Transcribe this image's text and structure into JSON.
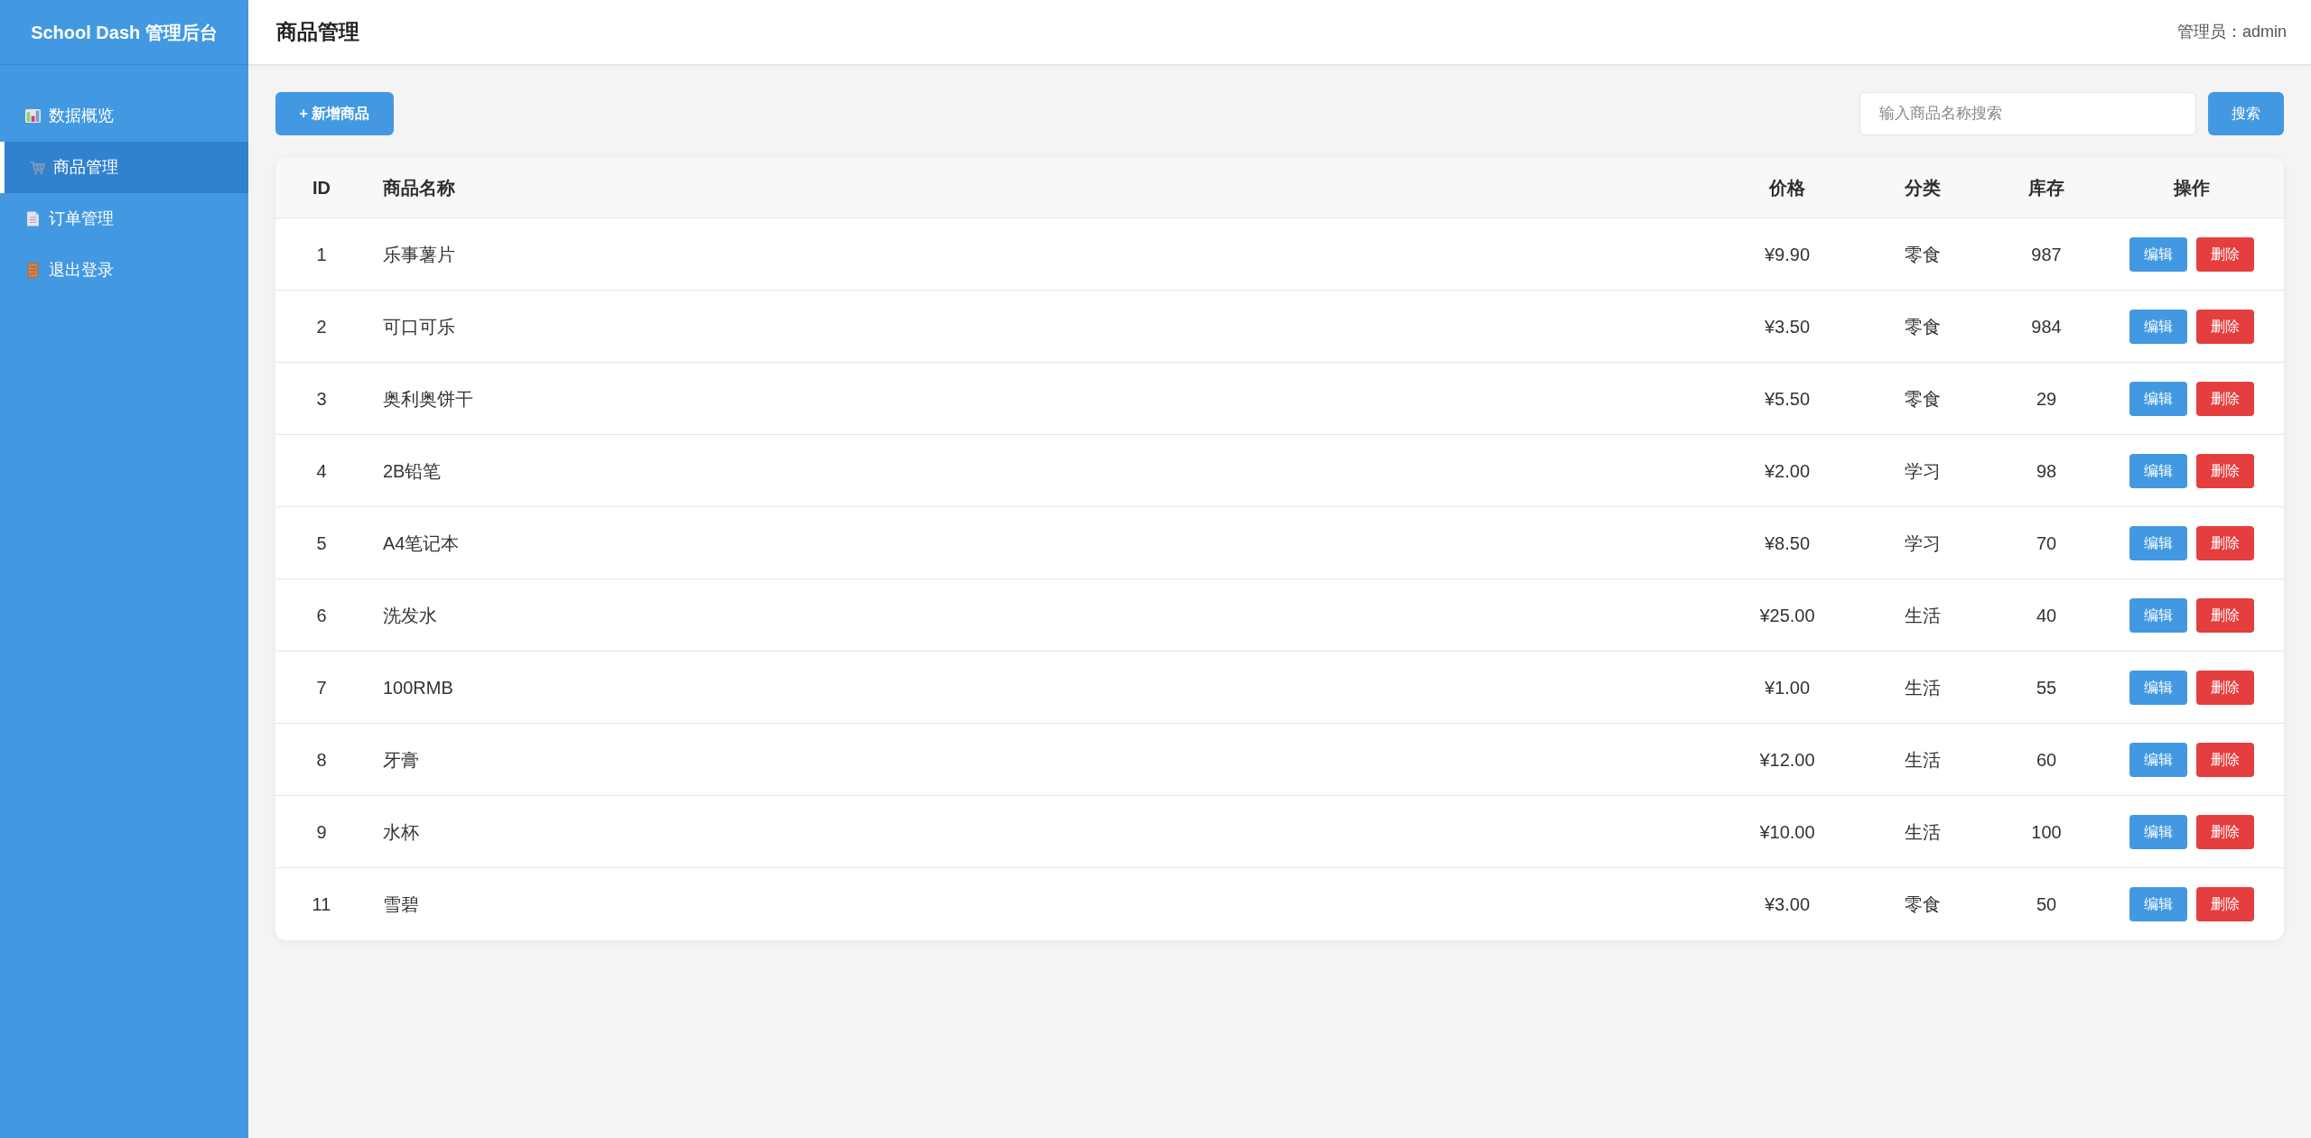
{
  "sidebar": {
    "title": "School Dash 管理后台",
    "items": [
      {
        "label": "数据概览",
        "kind": "dashboard",
        "selected": false
      },
      {
        "label": "商品管理",
        "kind": "products",
        "selected": true
      },
      {
        "label": "订单管理",
        "kind": "orders",
        "selected": false
      },
      {
        "label": "退出登录",
        "kind": "logout",
        "selected": false
      }
    ]
  },
  "header": {
    "title": "商品管理",
    "user": "管理员：admin"
  },
  "toolbar": {
    "add_button": "+ 新增商品",
    "search": {
      "placeholder": "输入商品名称搜索"
    },
    "search_button": "搜索"
  },
  "table": {
    "columns": [
      "ID",
      "商品名称",
      "价格",
      "分类",
      "库存",
      "操作"
    ],
    "rows": [
      {
        "cells": [
          "1",
          "乐事薯片",
          "¥9.90",
          "零食",
          "987"
        ],
        "actions": [
          {
            "label": "编辑",
            "kind": "edit"
          },
          {
            "label": "删除",
            "kind": "delete"
          }
        ]
      },
      {
        "cells": [
          "2",
          "可口可乐",
          "¥3.50",
          "零食",
          "984"
        ],
        "actions": [
          {
            "label": "编辑",
            "kind": "edit"
          },
          {
            "label": "删除",
            "kind": "delete"
          }
        ]
      },
      {
        "cells": [
          "3",
          "奥利奥饼干",
          "¥5.50",
          "零食",
          "29"
        ],
        "actions": [
          {
            "label": "编辑",
            "kind": "edit"
          },
          {
            "label": "删除",
            "kind": "delete"
          }
        ]
      },
      {
        "cells": [
          "4",
          "2B铅笔",
          "¥2.00",
          "学习",
          "98"
        ],
        "actions": [
          {
            "label": "编辑",
            "kind": "edit"
          },
          {
            "label": "删除",
            "kind": "delete"
          }
        ]
      },
      {
        "cells": [
          "5",
          "A4笔记本",
          "¥8.50",
          "学习",
          "70"
        ],
        "actions": [
          {
            "label": "编辑",
            "kind": "edit"
          },
          {
            "label": "删除",
            "kind": "delete"
          }
        ]
      },
      {
        "cells": [
          "6",
          "洗发水",
          "¥25.00",
          "生活",
          "40"
        ],
        "actions": [
          {
            "label": "编辑",
            "kind": "edit"
          },
          {
            "label": "删除",
            "kind": "delete"
          }
        ]
      },
      {
        "cells": [
          "7",
          "100RMB",
          "¥1.00",
          "生活",
          "55"
        ],
        "actions": [
          {
            "label": "编辑",
            "kind": "edit"
          },
          {
            "label": "删除",
            "kind": "delete"
          }
        ]
      },
      {
        "cells": [
          "8",
          "牙膏",
          "¥12.00",
          "生活",
          "60"
        ],
        "actions": [
          {
            "label": "编辑",
            "kind": "edit"
          },
          {
            "label": "删除",
            "kind": "delete"
          }
        ]
      },
      {
        "cells": [
          "9",
          "水杯",
          "¥10.00",
          "生活",
          "100"
        ],
        "actions": [
          {
            "label": "编辑",
            "kind": "edit"
          },
          {
            "label": "删除",
            "kind": "delete"
          }
        ]
      },
      {
        "cells": [
          "11",
          "雪碧",
          "¥3.00",
          "零食",
          "50"
        ],
        "actions": [
          {
            "label": "编辑",
            "kind": "edit"
          },
          {
            "label": "删除",
            "kind": "delete"
          }
        ]
      }
    ]
  }
}
